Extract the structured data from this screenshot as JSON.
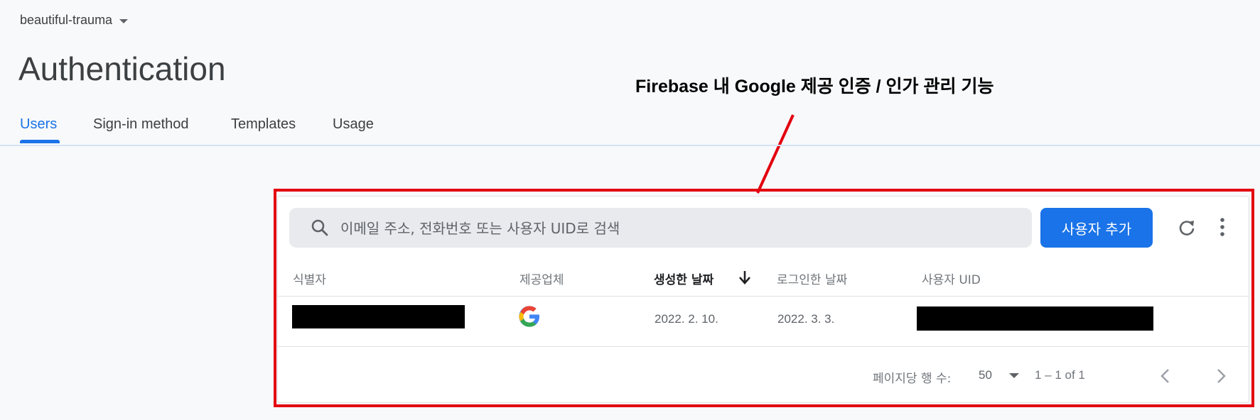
{
  "project": {
    "name": "beautiful-trauma"
  },
  "page": {
    "title": "Authentication"
  },
  "annotation": {
    "text": "Firebase 내 Google 제공 인증 / 인가 관리 기능"
  },
  "tabs": [
    {
      "label": "Users",
      "active": true
    },
    {
      "label": "Sign-in method"
    },
    {
      "label": "Templates"
    },
    {
      "label": "Usage"
    }
  ],
  "search": {
    "placeholder": "이메일 주소, 전화번호 또는 사용자 UID로 검색"
  },
  "toolbar": {
    "add_user_label": "사용자 추가"
  },
  "table": {
    "headers": [
      "식별자",
      "제공업체",
      "생성한 날짜",
      "로그인한 날짜",
      "사용자 UID"
    ],
    "sorted_column": "생성한 날짜",
    "rows": [
      {
        "identifier": "",
        "provider_icon": "google-icon",
        "created": "2022. 2. 10.",
        "signed_in": "2022. 3. 3.",
        "uid": ""
      }
    ]
  },
  "pagination": {
    "rows_per_page_label": "페이지당 행 수:",
    "rows_per_page": "50",
    "range": "1 – 1 of 1"
  },
  "colors": {
    "accent": "#1a73e8",
    "highlight": "#e3000f"
  }
}
